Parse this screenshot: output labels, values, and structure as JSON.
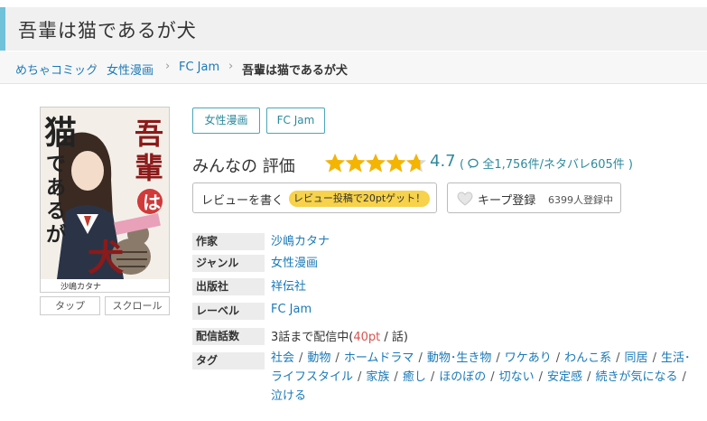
{
  "page": {
    "title": "吾輩は猫であるが犬"
  },
  "breadcrumb": [
    {
      "label": "めちゃコミック"
    },
    {
      "label": "女性漫画"
    },
    {
      "label": "FC Jam"
    },
    {
      "label": "吾輩は猫であるが犬"
    }
  ],
  "cover": {
    "title_text": "吾輩は猫であるが犬",
    "author_text": "沙嶋カタナ",
    "tap_label": "タップ",
    "scroll_label": "スクロール"
  },
  "genre_tags": [
    "女性漫画",
    "FC Jam"
  ],
  "rating": {
    "label": "みんなの 評価",
    "score": "4.7",
    "score_value": 4.7,
    "count_text": "全1,756件/ネタバレ605件",
    "open_paren": "(",
    "close_paren": ")",
    "star_color": "#f5b400"
  },
  "buttons": {
    "review_label": "レビューを書く",
    "review_badge": "レビュー投稿で20ptゲット！",
    "keep_label": "キープ登録",
    "keep_count": "6399人登録中"
  },
  "info": {
    "author_label": "作家",
    "author": "沙嶋カタナ",
    "genre_label": "ジャンル",
    "genre": "女性漫画",
    "publisher_label": "出版社",
    "publisher": "祥伝社",
    "label_label": "レーベル",
    "label": "FC Jam",
    "episodes_label": "配信話数",
    "episodes_prefix": "3話まで配信中(",
    "episodes_pt": "40pt",
    "episodes_suffix": " / 話)",
    "tags_label": "タグ",
    "tags": [
      "社会",
      "動物",
      "ホームドラマ",
      "動物･生き物",
      "ワケあり",
      "わんこ系",
      "同居",
      "生活･ライフスタイル",
      "家族",
      "癒し",
      "ほのぼの",
      "切ない",
      "安定感",
      "続きが気になる",
      "泣ける"
    ]
  },
  "colors": {
    "accent": "#6fc2d8",
    "link": "#1a79b8",
    "teal": "#2d8a9c",
    "badge": "#f7d24a"
  }
}
